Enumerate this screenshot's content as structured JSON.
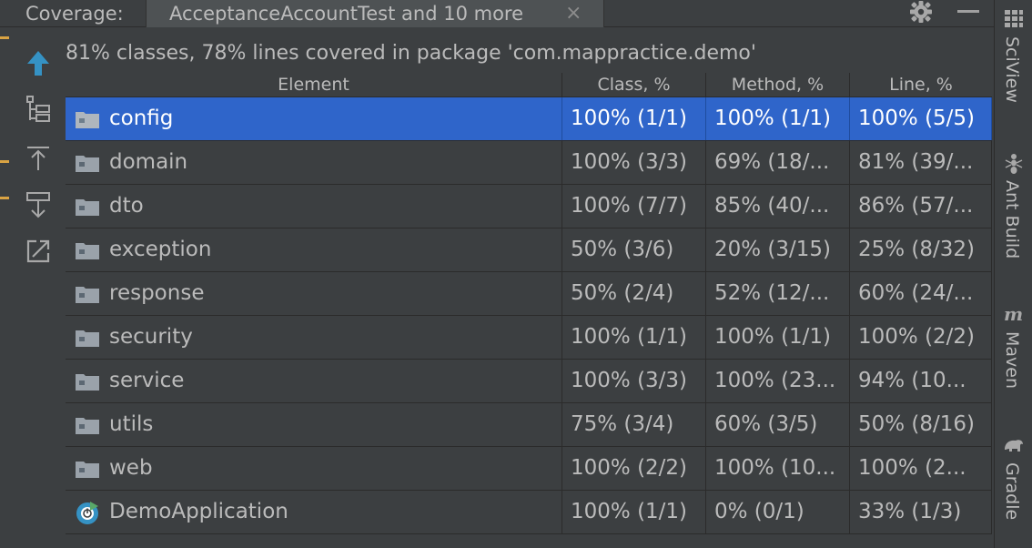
{
  "header": {
    "label": "Coverage:",
    "tab_title": "AcceptanceAccountTest and 10 more",
    "tab_close": "×"
  },
  "summary": "81% classes, 78% lines covered in package 'com.mappractice.demo'",
  "columns": [
    "Element",
    "Class, %",
    "Method, %",
    "Line, %"
  ],
  "rows": [
    {
      "name": "config",
      "class": "100% (1/1)",
      "method": "100% (1/1)",
      "line": "100% (5/5)",
      "icon": "folder-icon",
      "selected": true
    },
    {
      "name": "domain",
      "class": "100% (3/3)",
      "method": "69% (18/...",
      "line": "81% (39/...",
      "icon": "folder-icon"
    },
    {
      "name": "dto",
      "class": "100% (7/7)",
      "method": "85% (40/...",
      "line": "86% (57/...",
      "icon": "folder-icon"
    },
    {
      "name": "exception",
      "class": "50% (3/6)",
      "method": "20% (3/15)",
      "line": "25% (8/32)",
      "icon": "folder-icon"
    },
    {
      "name": "response",
      "class": "50% (2/4)",
      "method": "52% (12/...",
      "line": "60% (24/...",
      "icon": "folder-icon"
    },
    {
      "name": "security",
      "class": "100% (1/1)",
      "method": "100% (1/1)",
      "line": "100% (2/2)",
      "icon": "folder-icon"
    },
    {
      "name": "service",
      "class": "100% (3/3)",
      "method": "100% (23...",
      "line": "94% (10...",
      "icon": "folder-icon"
    },
    {
      "name": "utils",
      "class": "75% (3/4)",
      "method": "60% (3/5)",
      "line": "50% (8/16)",
      "icon": "folder-icon"
    },
    {
      "name": "web",
      "class": "100% (2/2)",
      "method": "100% (10...",
      "line": "100% (2...",
      "icon": "folder-icon"
    },
    {
      "name": "DemoApplication",
      "class": "100% (1/1)",
      "method": "0% (0/1)",
      "line": "33% (1/3)",
      "icon": "spring-boot-app-icon"
    }
  ],
  "sidebar": {
    "sciview": "SciView",
    "ant": "Ant Build",
    "maven": "Maven",
    "gradle": "Gradle"
  },
  "colors": {
    "background": "#3c3f41",
    "selection": "#2f65ca",
    "accent_blue": "#3592c4",
    "text": "#bbbbbb"
  }
}
